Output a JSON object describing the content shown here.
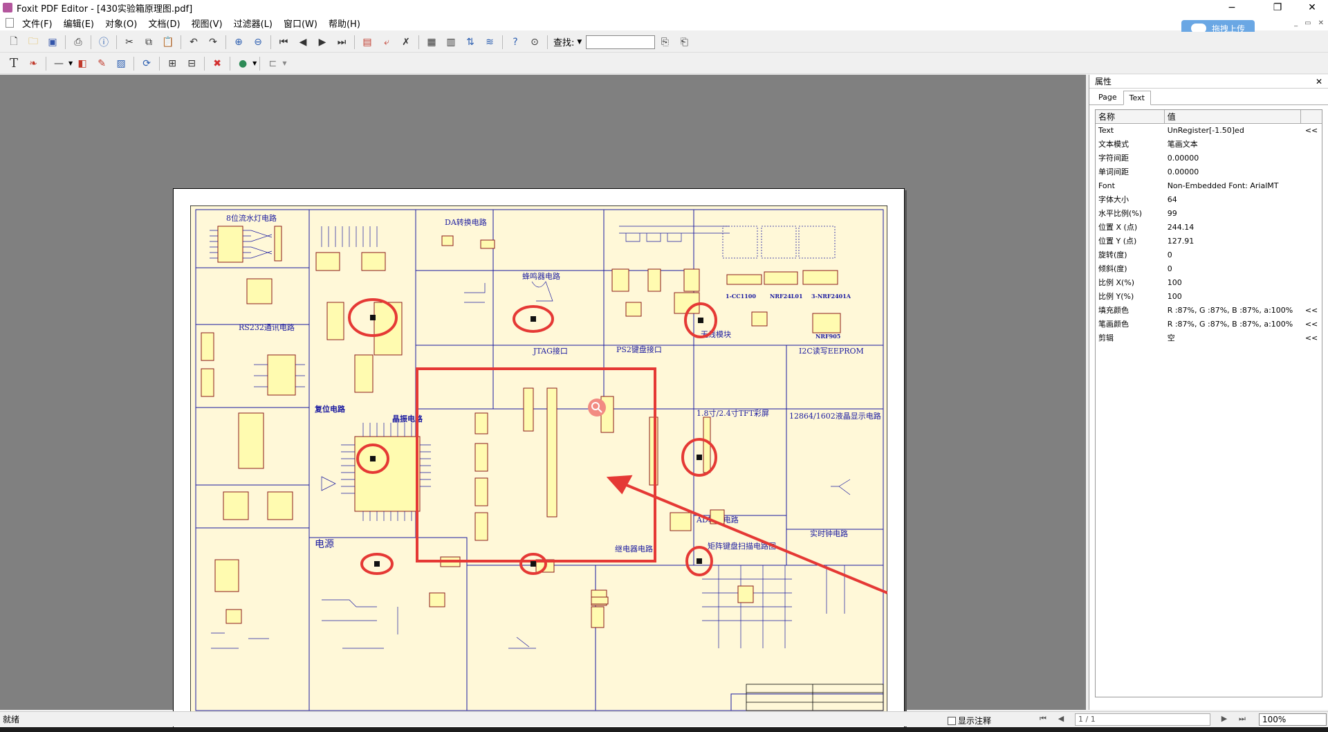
{
  "window": {
    "title": "Foxit PDF Editor - [430实验箱原理图.pdf]",
    "minimize": "−",
    "restore": "❐",
    "close": "✕"
  },
  "menu": [
    "文件(F)",
    "编辑(E)",
    "对象(O)",
    "文档(D)",
    "视图(V)",
    "过滤器(L)",
    "窗口(W)",
    "帮助(H)"
  ],
  "cloud_upload": "拖拽上传",
  "find": {
    "label": "查找:",
    "value": ""
  },
  "schematic": {
    "sections": [
      "8位流水灯电路",
      "RS232通讯电路",
      "DA转换电路",
      "蜂鸣器电路",
      "JTAG接口",
      "PS2键盘接口",
      "I2C读写EEPROM",
      "1.8寸/2.4寸TFT彩屏",
      "12864/1602液晶显示电路",
      "复位电路",
      "晶振电路",
      "AD输入电路",
      "实时钟电路",
      "电源",
      "继电器电路",
      "矩阵键盘扫描电路图",
      "无线模块",
      "1-CC1100",
      "NRF24L01",
      "3-NRF2401A",
      "NRF905"
    ],
    "annotation_color": "#e53935"
  },
  "panel": {
    "title": "属性",
    "tabs": [
      "Page",
      "Text"
    ],
    "active_tab": "Text",
    "header": {
      "name": "名称",
      "value": "值"
    },
    "rows": [
      {
        "name": "Text",
        "value": "UnRegister[-1.50]ed",
        "more": "<<"
      },
      {
        "name": "文本模式",
        "value": "笔画文本",
        "more": ""
      },
      {
        "name": "字符间距",
        "value": "0.00000",
        "more": ""
      },
      {
        "name": "单词间距",
        "value": "0.00000",
        "more": ""
      },
      {
        "name": "Font",
        "value": "Non-Embedded Font: ArialMT",
        "more": ""
      },
      {
        "name": "字体大小",
        "value": "64",
        "more": ""
      },
      {
        "name": "水平比例(%)",
        "value": "99",
        "more": ""
      },
      {
        "name": "位置 X (点)",
        "value": "244.14",
        "more": ""
      },
      {
        "name": "位置 Y (点)",
        "value": "127.91",
        "more": ""
      },
      {
        "name": "旋转(度)",
        "value": "0",
        "more": ""
      },
      {
        "name": "倾斜(度)",
        "value": "0",
        "more": ""
      },
      {
        "name": "比例 X(%)",
        "value": "100",
        "more": ""
      },
      {
        "name": "比例 Y(%)",
        "value": "100",
        "more": ""
      },
      {
        "name": "填充颜色",
        "value": "R :87%, G :87%, B :87%, a:100%",
        "more": "<<"
      },
      {
        "name": "笔画颜色",
        "value": "R :87%, G :87%, B :87%, a:100%",
        "more": "<<"
      },
      {
        "name": "剪辑",
        "value": "空",
        "more": "<<"
      }
    ]
  },
  "status": {
    "text": "就绪",
    "show_annotations": "显示注释",
    "page": "1 / 1",
    "zoom": "100%"
  }
}
